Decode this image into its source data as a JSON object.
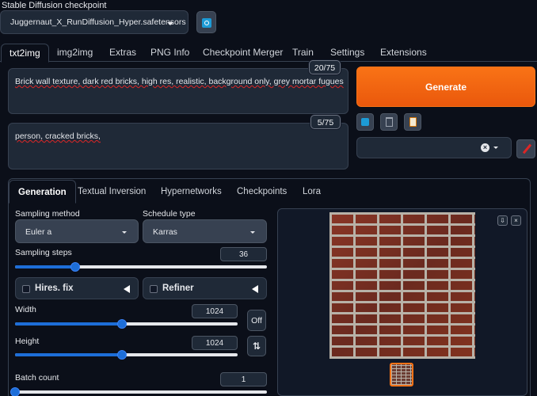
{
  "checkpoint": {
    "label": "Stable Diffusion checkpoint",
    "value": "Juggernaut_X_RunDiffusion_Hyper.safetensors",
    "refresh_icon": "refresh-icon"
  },
  "main_tabs": [
    {
      "label": "txt2img",
      "active": true
    },
    {
      "label": "img2img"
    },
    {
      "label": "Extras"
    },
    {
      "label": "PNG Info"
    },
    {
      "label": "Checkpoint Merger"
    },
    {
      "label": "Train"
    },
    {
      "label": "Settings"
    },
    {
      "label": "Extensions"
    }
  ],
  "prompt": {
    "text": "Brick wall texture, dark red bricks, high res, realistic, background only, grey mortar fugues",
    "counter": "20/75"
  },
  "negative_prompt": {
    "text": "person, cracked bricks,",
    "counter": "5/75"
  },
  "generate_label": "Generate",
  "tool_icons": [
    "checkbox-icon",
    "trash-icon",
    "clipboard-icon"
  ],
  "styles_clear_icon": "close-icon",
  "edit_icon": "paintbrush-icon",
  "sub_tabs": [
    {
      "label": "Generation",
      "active": true
    },
    {
      "label": "Textual Inversion"
    },
    {
      "label": "Hypernetworks"
    },
    {
      "label": "Checkpoints"
    },
    {
      "label": "Lora"
    }
  ],
  "sampling_method": {
    "label": "Sampling method",
    "value": "Euler a"
  },
  "schedule_type": {
    "label": "Schedule type",
    "value": "Karras"
  },
  "sampling_steps": {
    "label": "Sampling steps",
    "value": "36",
    "fraction": 0.24
  },
  "hires_fix": {
    "label": "Hires. fix",
    "checked": false
  },
  "refiner": {
    "label": "Refiner",
    "checked": false
  },
  "width": {
    "label": "Width",
    "value": "1024",
    "fraction": 0.48
  },
  "height": {
    "label": "Height",
    "value": "1024",
    "fraction": 0.48
  },
  "off_label": "Off",
  "swap_icon": "swap-vertical-icon",
  "batch_count": {
    "label": "Batch count",
    "value": "1",
    "fraction": 0.0
  },
  "gallery": {
    "download_icon": "download-icon",
    "close_icon": "close-icon"
  },
  "colors": {
    "accent": "#ea580c",
    "slider": "#1d6ed8",
    "background": "#0b0f19"
  }
}
